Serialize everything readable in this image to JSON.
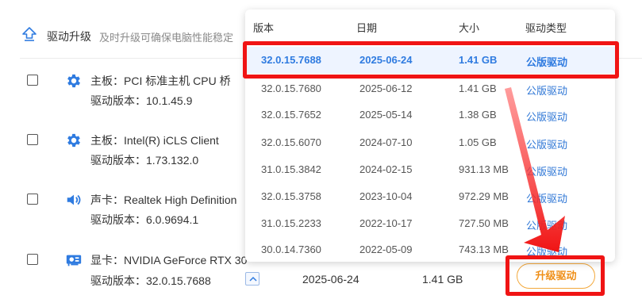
{
  "header": {
    "title": "驱动升级",
    "subtitle": "及时升级可确保电脑性能稳定"
  },
  "devices": [
    {
      "name": "主板：PCI 标准主机 CPU 桥",
      "version": "驱动版本：10.1.45.9",
      "icon": "gear-icon"
    },
    {
      "name": "主板：Intel(R) iCLS Client",
      "version": "驱动版本：1.73.132.0",
      "icon": "gear-icon"
    },
    {
      "name": "声卡：Realtek High Definition",
      "version": "驱动版本：6.0.9694.1",
      "icon": "speaker-icon"
    },
    {
      "name": "显卡：NVIDIA GeForce RTX 30",
      "version": "驱动版本：32.0.15.7688",
      "icon": "gpu-card-icon"
    }
  ],
  "current": {
    "date": "2025-06-24",
    "size": "1.41 GB",
    "upgrade_label": "升级驱动"
  },
  "dropdown": {
    "headers": [
      "版本",
      "日期",
      "大小",
      "驱动类型"
    ],
    "rows": [
      {
        "version": "32.0.15.7688",
        "date": "2025-06-24",
        "size": "1.41 GB",
        "type": "公版驱动"
      },
      {
        "version": "32.0.15.7680",
        "date": "2025-06-12",
        "size": "1.41 GB",
        "type": "公版驱动"
      },
      {
        "version": "32.0.15.7652",
        "date": "2025-05-14",
        "size": "1.38 GB",
        "type": "公版驱动"
      },
      {
        "version": "32.0.15.6070",
        "date": "2024-07-10",
        "size": "1.05 GB",
        "type": "公版驱动"
      },
      {
        "version": "31.0.15.3842",
        "date": "2024-02-15",
        "size": "931.13 MB",
        "type": "公版驱动"
      },
      {
        "version": "32.0.15.3758",
        "date": "2023-10-04",
        "size": "972.29 MB",
        "type": "公版驱动"
      },
      {
        "version": "31.0.15.2233",
        "date": "2022-10-17",
        "size": "727.50 MB",
        "type": "公版驱动"
      },
      {
        "version": "30.0.14.7360",
        "date": "2022-05-09",
        "size": "743.13 MB",
        "type": "公版驱动"
      }
    ]
  },
  "colors": {
    "accent_blue": "#2f7be0",
    "upgrade_orange": "#ef8f18",
    "annotation_red": "#f01414"
  }
}
